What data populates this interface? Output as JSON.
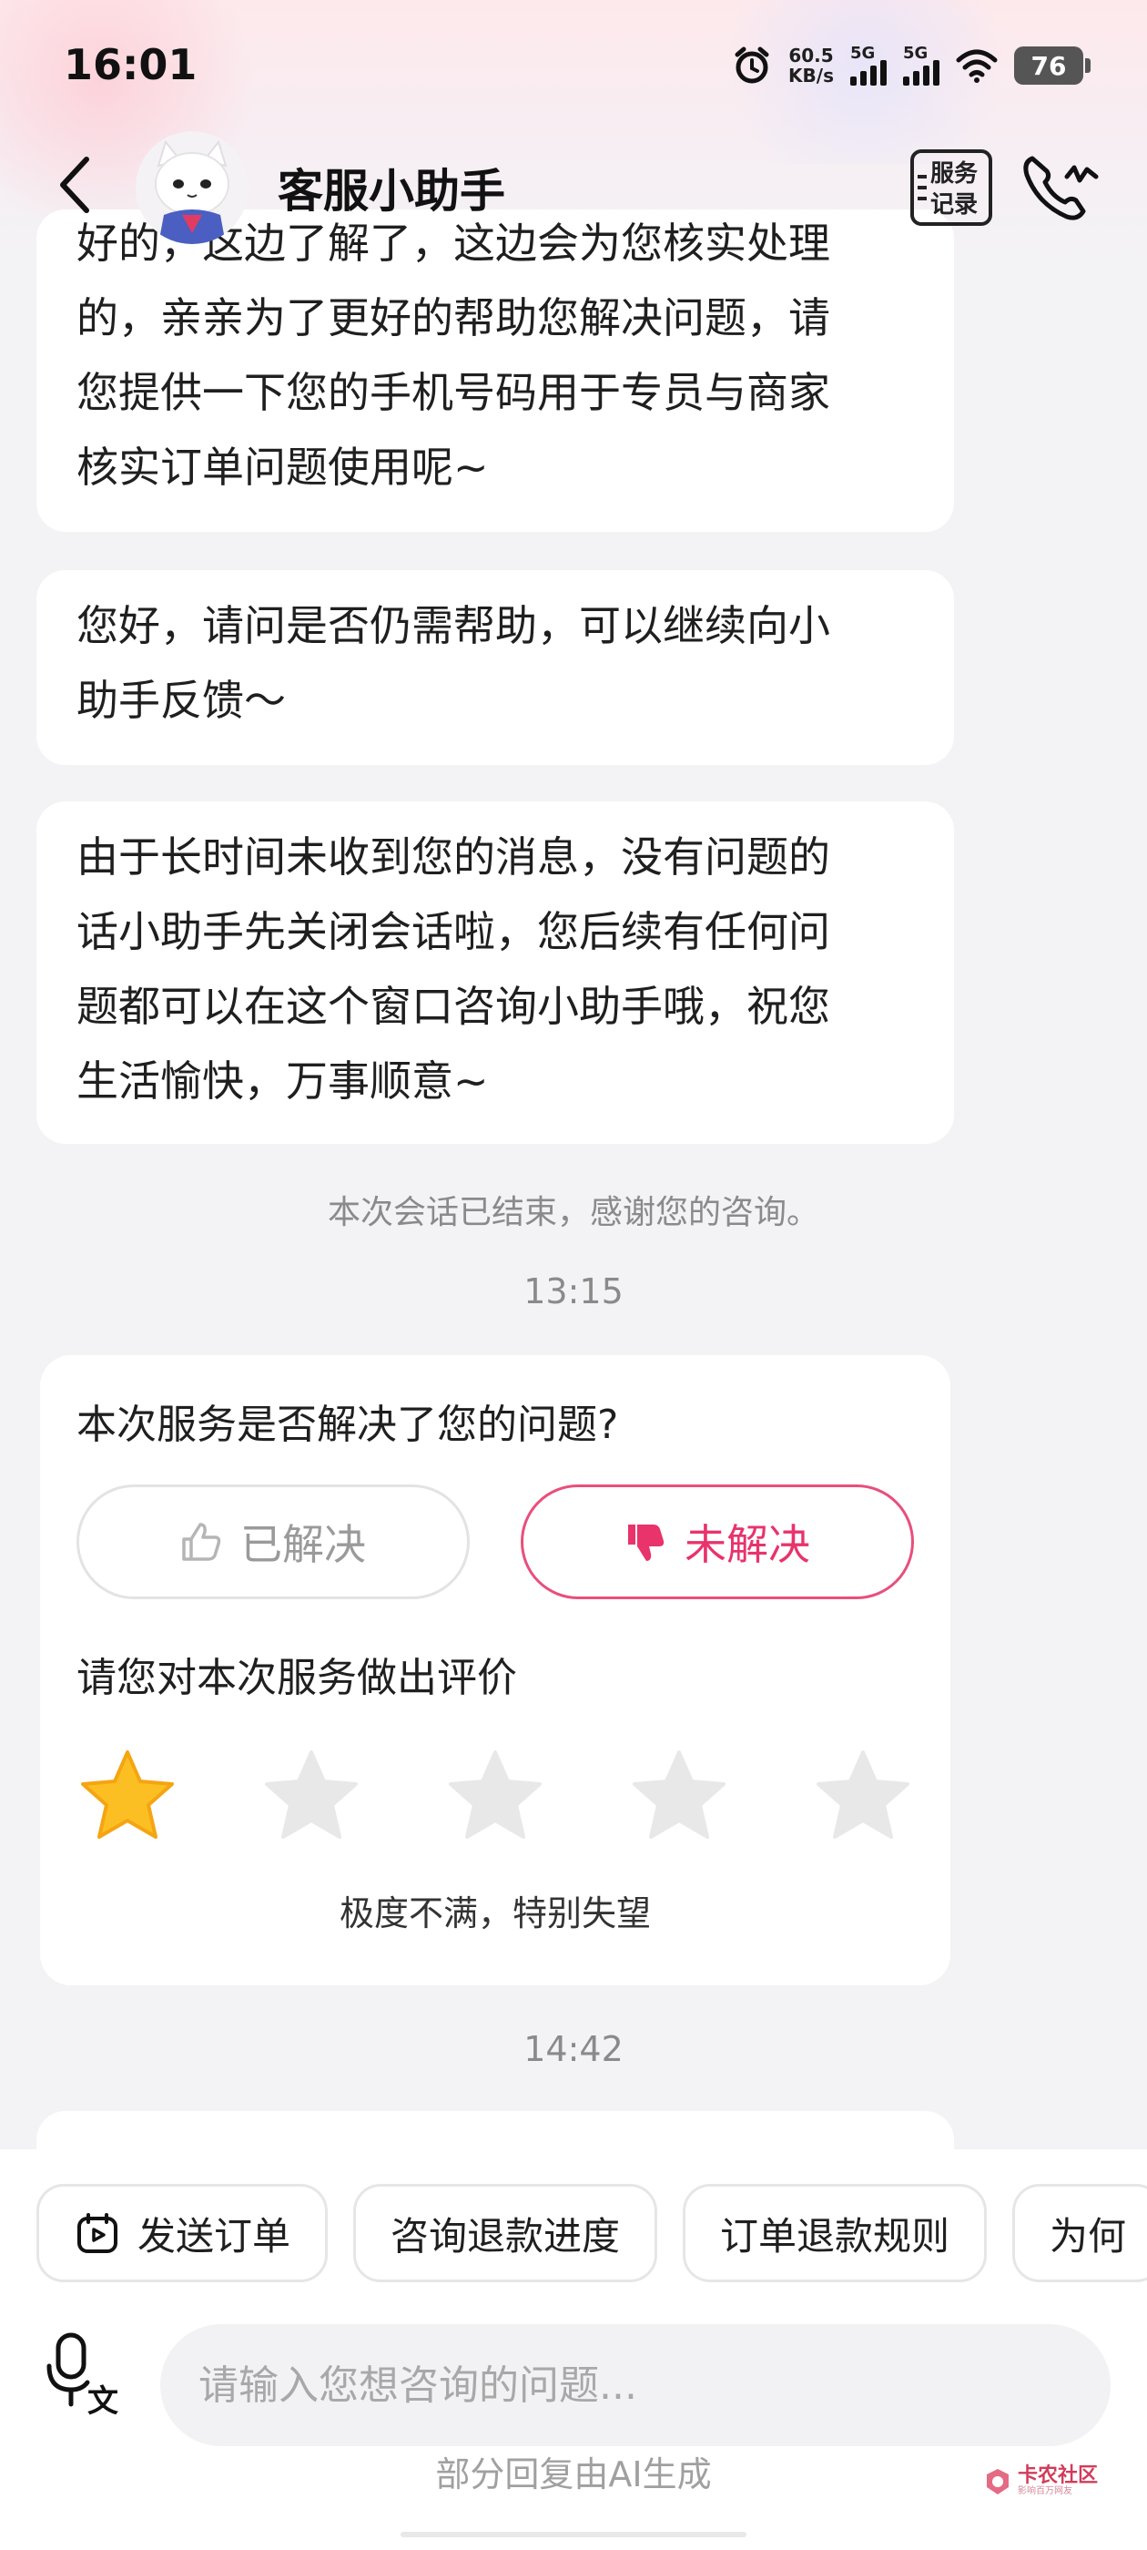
{
  "status_bar": {
    "time": "16:01",
    "net_speed_value": "60.5",
    "net_speed_unit": "KB/s",
    "sim1_label": "5G",
    "sim2_label": "5G",
    "battery": "76"
  },
  "header": {
    "title": "客服小助手",
    "service_record_line1": "服务",
    "service_record_line2": "记录"
  },
  "messages": [
    {
      "lines": [
        "好的，这边了解了，这边会为您核实处理",
        "的，亲亲为了更好的帮助您解决问题，请",
        "您提供一下您的手机号码用于专员与商家",
        "核实订单问题使用呢~"
      ]
    },
    {
      "lines": [
        "您好，请问是否仍需帮助，可以继续向小",
        "助手反馈～"
      ]
    },
    {
      "lines": [
        "由于长时间未收到您的消息，没有问题的",
        "话小助手先关闭会话啦，您后续有任何问",
        "题都可以在这个窗口咨询小助手哦，祝您",
        "生活愉快，万事顺意~"
      ]
    }
  ],
  "session_end_note": "本次会话已结束，感谢您的咨询。",
  "timestamps": [
    "13:15",
    "14:42"
  ],
  "feedback": {
    "question": "本次服务是否解决了您的问题?",
    "resolved_label": "已解决",
    "unresolved_label": "未解决",
    "selected": "unresolved",
    "rating_prompt": "请您对本次服务做出评价",
    "rating": 1,
    "rating_max": 5,
    "rating_label": "极度不满，特别失望",
    "colors": {
      "accent": "#e8336b",
      "star_on": "#fbbf24",
      "star_off": "#e8e8e8"
    }
  },
  "quick_actions": [
    {
      "label": "发送订单",
      "icon": "order-icon"
    },
    {
      "label": "咨询退款进度"
    },
    {
      "label": "订单退款规则"
    },
    {
      "label": "为何"
    }
  ],
  "input": {
    "placeholder": "请输入您想咨询的问题..."
  },
  "ai_note": "部分回复由AI生成",
  "watermark": {
    "text": "卡农社区",
    "sub": "影响百万网友"
  }
}
